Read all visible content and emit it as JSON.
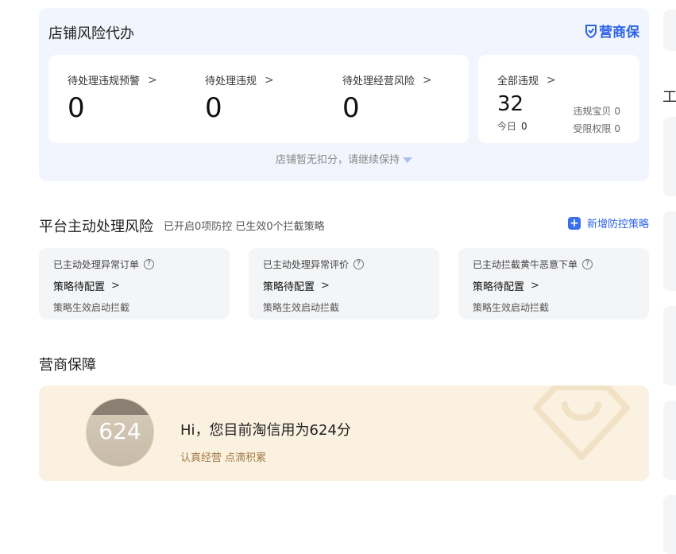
{
  "risk": {
    "title": "店铺风险代办",
    "brand": "营商保",
    "metrics": [
      {
        "label": "待处理违规预警",
        "value": "0"
      },
      {
        "label": "待处理违规",
        "value": "0"
      },
      {
        "label": "待处理经营风险",
        "value": "0"
      }
    ],
    "all_violations": {
      "label": "全部违规",
      "value": "32",
      "today_label": "今日",
      "today_value": "0",
      "items_label": "违规宝贝",
      "items_value": "0",
      "restricted_label": "受限权限",
      "restricted_value": "0"
    },
    "notice": "店铺暂无扣分，请继续保持"
  },
  "platform": {
    "title": "平台主动处理风险",
    "subtitle": "已开启0项防控 已生效0个拦截策略",
    "add_button": "新增防控策略",
    "cards": [
      {
        "title": "已主动处理异常订单",
        "status": "策略待配置",
        "desc": "策略生效启动拦截"
      },
      {
        "title": "已主动处理异常评价",
        "status": "策略待配置",
        "desc": "策略生效启动拦截"
      },
      {
        "title": "已主动拦截黄牛恶意下单",
        "status": "策略待配置",
        "desc": "策略生效启动拦截"
      }
    ]
  },
  "protection": {
    "title": "营商保障",
    "score": "624",
    "message": "Hi，您目前淘信用为624分",
    "sub": "认真经营 点滴积累"
  },
  "right_column": {
    "heading_char": "工"
  },
  "colors": {
    "accent": "#2b63e8",
    "risk_bg": "#f2f5fd",
    "protection_bg": "#faf1e0",
    "protection_sub": "#a07a45"
  }
}
